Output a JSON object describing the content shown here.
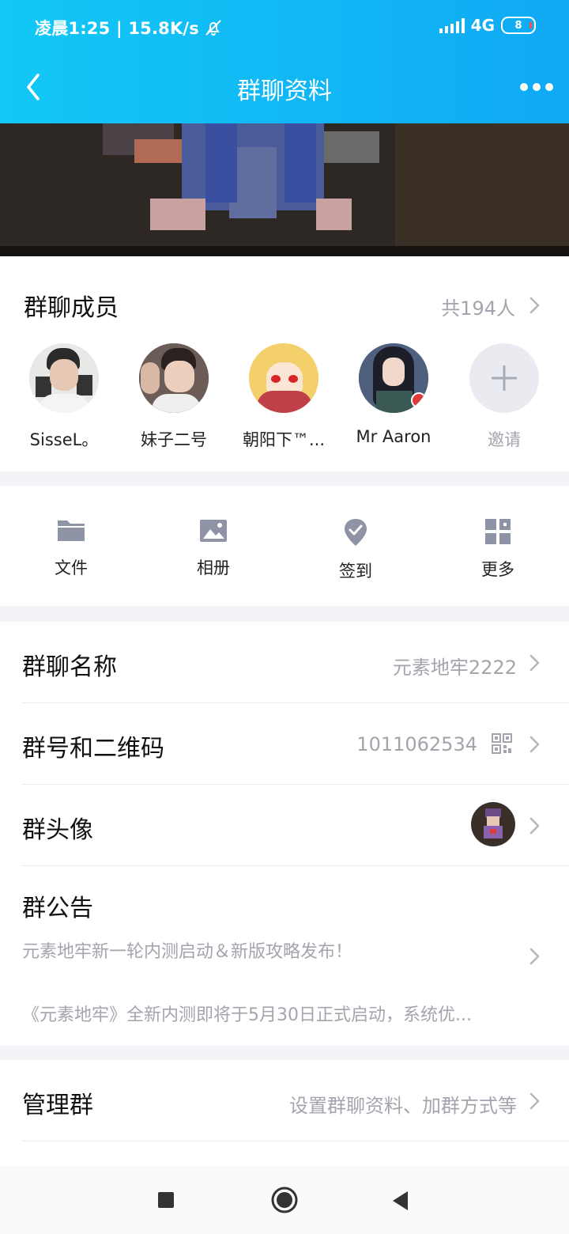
{
  "status": {
    "time_speed": "凌晨1:25 | 15.8K/s",
    "network": "4G",
    "battery": "8"
  },
  "nav": {
    "title": "群聊资料"
  },
  "members": {
    "title": "群聊成员",
    "count": "共194人",
    "list": [
      {
        "name": "SisseL。"
      },
      {
        "name": "妹子二号"
      },
      {
        "name": "朝阳下™..."
      },
      {
        "name": "Mr   Aaron"
      }
    ],
    "invite_label": "邀请"
  },
  "shortcuts": [
    {
      "label": "文件",
      "icon": "folder-icon"
    },
    {
      "label": "相册",
      "icon": "image-icon"
    },
    {
      "label": "签到",
      "icon": "checkin-icon"
    },
    {
      "label": "更多",
      "icon": "grid-icon"
    }
  ],
  "settings": {
    "name": {
      "title": "群聊名称",
      "value": "元素地牢2222"
    },
    "id": {
      "title": "群号和二维码",
      "value": "1011062534"
    },
    "avatar": {
      "title": "群头像"
    },
    "notice": {
      "title": "群公告",
      "line1": "元素地牢新一轮内测启动＆新版攻略发布！",
      "line2": "《元素地牢》全新内测即将于5月30日正式启动，系统优..."
    }
  },
  "manage": {
    "title": "管理群",
    "value": "设置群聊资料、加群方式等"
  },
  "colors": {
    "header_start": "#12c8f6",
    "header_end": "#10a9f4",
    "secondary_text": "#a2a5ad",
    "icon_gray": "#8e93a6"
  }
}
